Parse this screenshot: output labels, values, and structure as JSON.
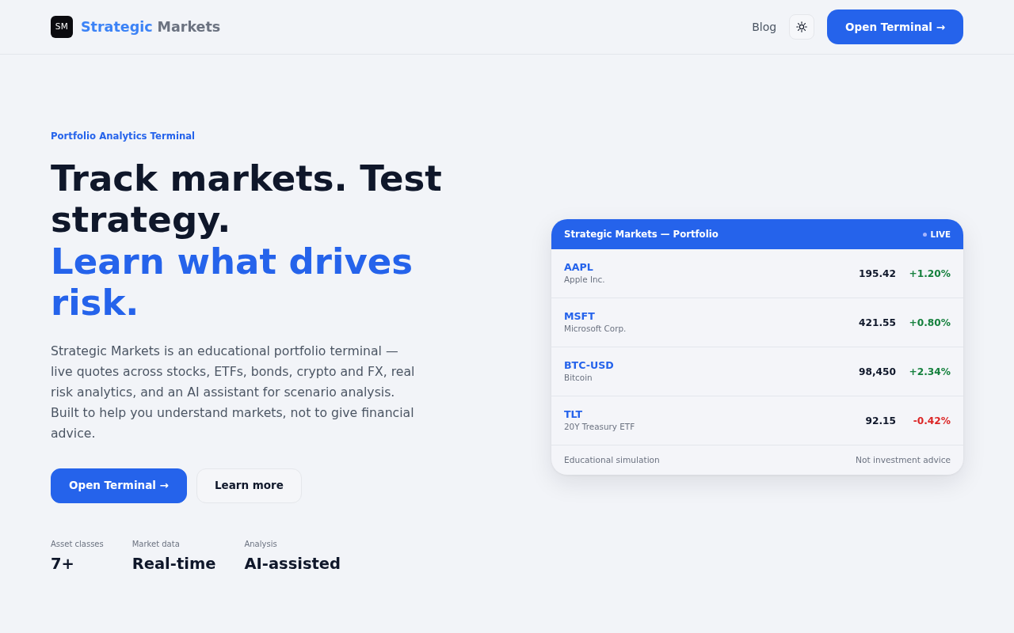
{
  "nav": {
    "logo_mark": "SM",
    "brand": [
      "Strategic",
      "Markets"
    ],
    "links": [
      "Blog"
    ],
    "cta": "Open Terminal →"
  },
  "hero": {
    "eyebrow": "Portfolio Analytics Terminal",
    "headline": "Track markets. Test strategy.",
    "headline_accent": "Learn what drives risk.",
    "description": "Strategic Markets is an educational portfolio terminal — live quotes across stocks, ETFs, bonds, crypto and FX, real risk analytics, and an AI assistant for scenario analysis. Built to help you understand markets, not to give financial advice.",
    "buttons": [
      {
        "label": "Open Terminal →",
        "kind": "primary"
      },
      {
        "label": "Learn more",
        "kind": "secondary"
      }
    ],
    "stats": [
      {
        "label": "Asset classes",
        "value": "7+"
      },
      {
        "label": "Market data",
        "value": "Real-time"
      },
      {
        "label": "Analysis",
        "value": "AI-assisted"
      }
    ]
  },
  "portfolio_card": {
    "title": "Strategic Markets — Portfolio",
    "status": "LIVE",
    "quotes": [
      {
        "ticker": "AAPL",
        "name": "Apple Inc.",
        "price": "195.42",
        "change": "+1.20%",
        "color": "#15803d"
      },
      {
        "ticker": "MSFT",
        "name": "Microsoft Corp.",
        "price": "421.55",
        "change": "+0.80%",
        "color": "#15803d"
      },
      {
        "ticker": "BTC-USD",
        "name": "Bitcoin",
        "price": "98,450",
        "change": "+2.34%",
        "color": "#15803d"
      },
      {
        "ticker": "TLT",
        "name": "20Y Treasury ETF",
        "price": "92.15",
        "change": "-0.42%",
        "color": "#dc2626"
      }
    ],
    "footer": [
      "Educational simulation",
      "Not investment advice"
    ]
  }
}
